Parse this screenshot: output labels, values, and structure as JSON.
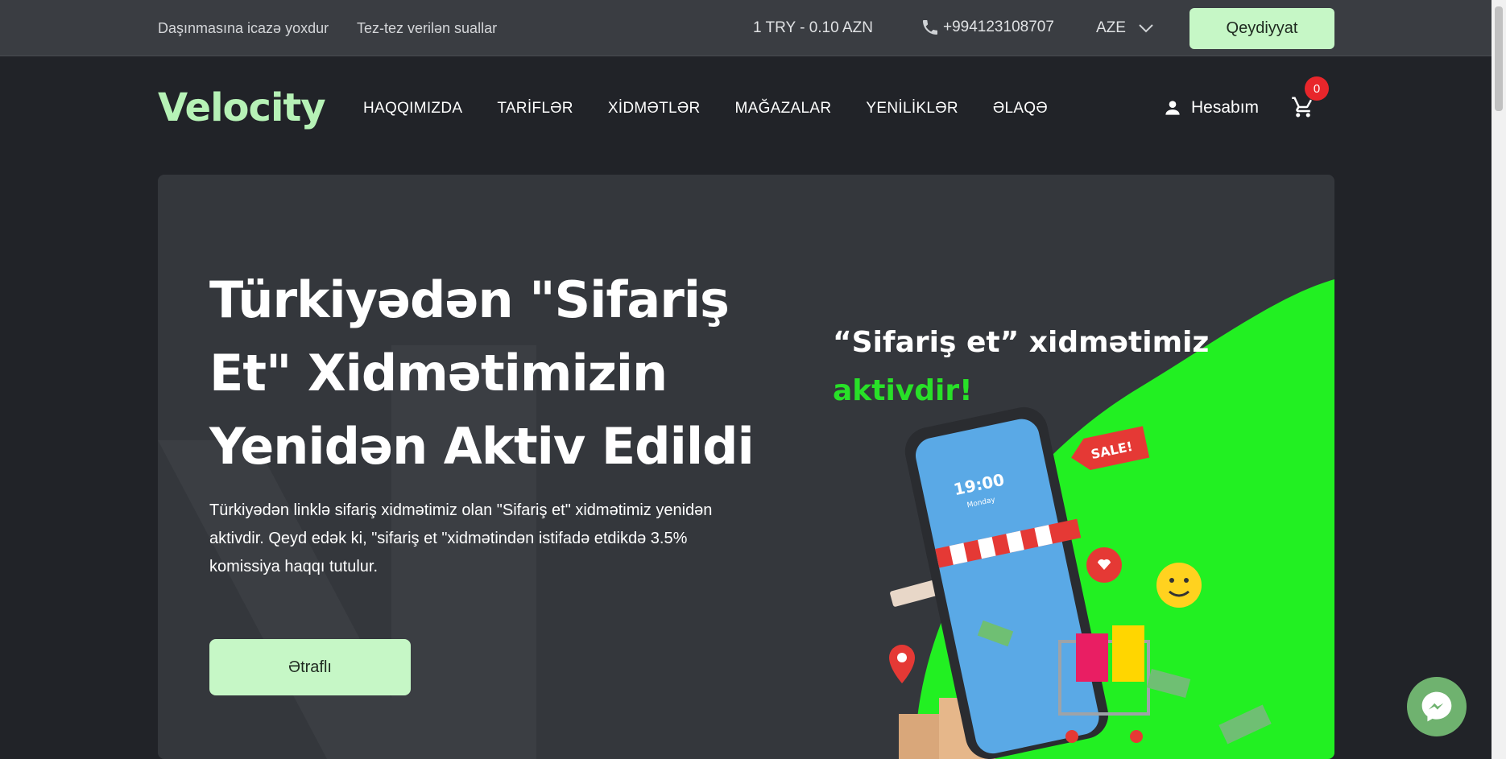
{
  "topbar": {
    "links": [
      "Daşınmasına icazə yoxdur",
      "Tez-tez verilən suallar"
    ],
    "rate": "1 TRY - 0.10 AZN",
    "phone": "+994123108707",
    "language": "AZE",
    "register_label": "Qeydiyyat"
  },
  "header": {
    "logo": "Velocity",
    "nav": [
      "HAQQIMIZDA",
      "TARİFLƏR",
      "XİDMƏTLƏR",
      "MAĞAZALAR",
      "YENİLİKLƏR",
      "ƏLAQƏ"
    ],
    "account_label": "Hesabım",
    "cart_count": "0"
  },
  "hero": {
    "title": "Türkiyədən \"Sifariş Et\" Xidmətimizin Yenidən Aktiv Edildi",
    "description": "Türkiyədən linklə sifariş xidmətimiz olan \"Sifariş et\" xidmətimiz yenidən aktivdir. Qeyd edək ki, \"sifariş et \"xidmətindən istifadə etdikdə 3.5% komissiya haqqı tutulur.",
    "more_label": "Ətraflı"
  },
  "promo": {
    "line1": "“Sifariş et” xidmətimiz",
    "line2": "aktivdir!",
    "sale_tag": "SALE!",
    "phone_time": "19:00",
    "phone_day": "Monday"
  },
  "colors": {
    "accent": "#c6f7c6",
    "promo_green": "#22f022",
    "background": "#212328",
    "badge": "#e8262b"
  }
}
